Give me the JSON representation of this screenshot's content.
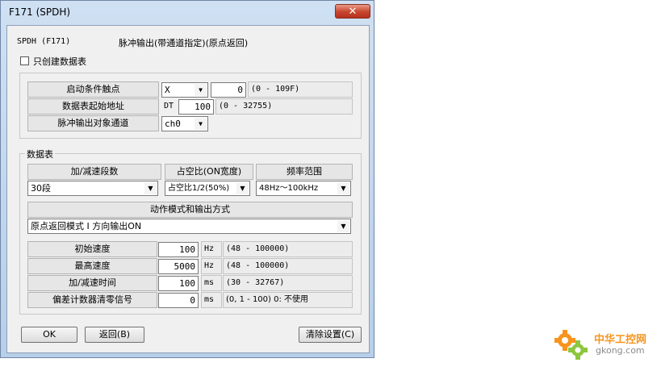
{
  "window": {
    "title": "F171 (SPDH)",
    "close_label": "✕"
  },
  "header": {
    "code": "SPDH (F171)",
    "description": "脉冲输出(带通道指定)(原点返回)"
  },
  "only_table_checkbox": {
    "label": "只创建数据表",
    "checked": false
  },
  "settings": {
    "start_contact": {
      "label": "启动条件触点",
      "device": "X",
      "address": "0",
      "range": "(0 - 109F)"
    },
    "table_start": {
      "label": "数据表起始地址",
      "prefix": "DT",
      "value": "100",
      "range": "(0 - 32755)"
    },
    "channel": {
      "label": "脉冲输出对象通道",
      "value": "ch0"
    }
  },
  "data_table": {
    "group_label": "数据表",
    "accel_steps": {
      "label": "加/减速段数",
      "value": "30段"
    },
    "duty": {
      "label": "占空比(ON宽度)",
      "value": "占空比1/2(50%)"
    },
    "freq_range": {
      "label": "频率范围",
      "value": "48Hz～100kHz"
    },
    "mode": {
      "label": "动作模式和输出方式",
      "value": "原点返回模式 I  方向输出ON"
    },
    "params": [
      {
        "label": "初始速度",
        "value": "100",
        "unit": "Hz",
        "range": "(48 - 100000)"
      },
      {
        "label": "最高速度",
        "value": "5000",
        "unit": "Hz",
        "range": "(48 - 100000)"
      },
      {
        "label": "加/减速时间",
        "value": "100",
        "unit": "ms",
        "range": "(30 - 32767)"
      },
      {
        "label": "偏差计数器清零信号",
        "value": "0",
        "unit": "ms",
        "range": "(0, 1 - 100)  0: 不使用"
      }
    ]
  },
  "buttons": {
    "ok": "OK",
    "back": "返回(B)",
    "clear": "清除设置(C)"
  },
  "watermark": {
    "brand": "中华工控网",
    "site": "gkong.com"
  }
}
